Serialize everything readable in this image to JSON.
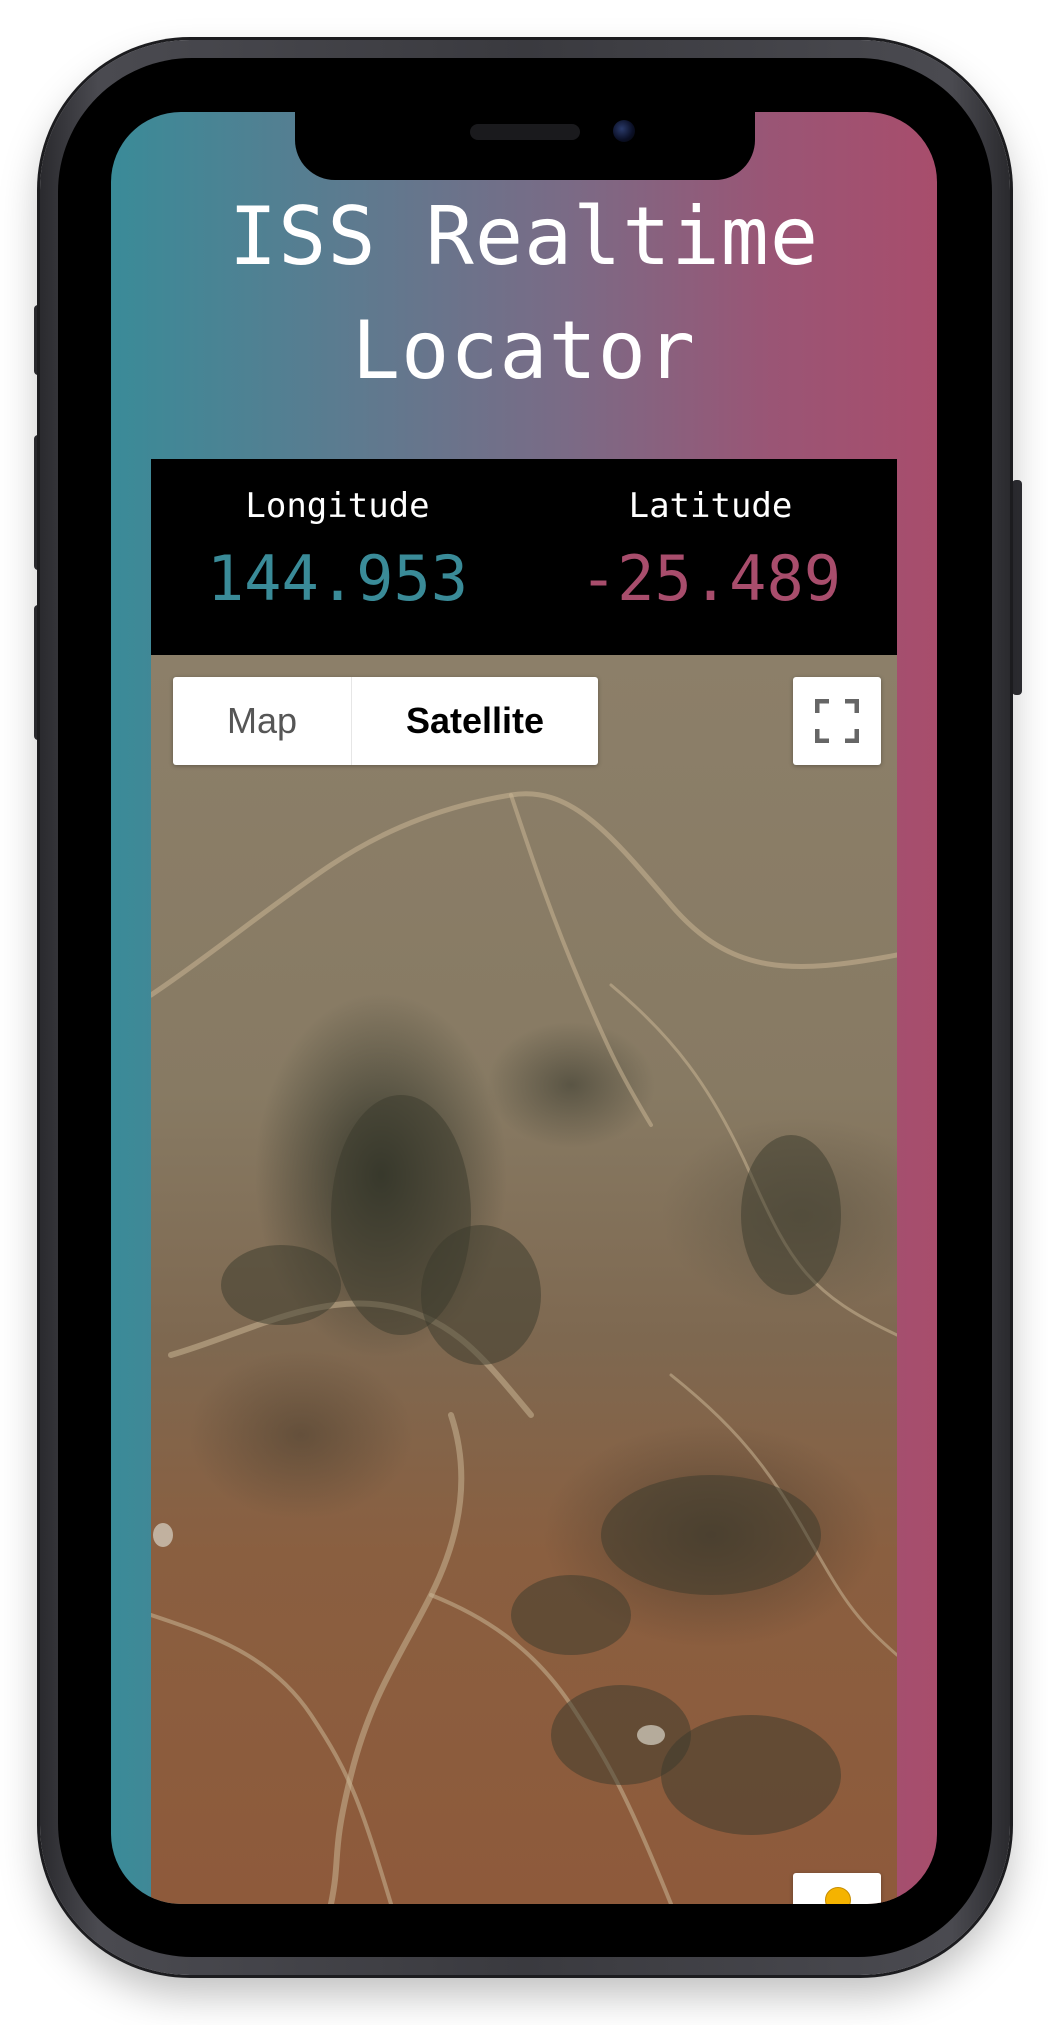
{
  "app": {
    "title": "ISS Realtime Locator"
  },
  "coordinates": {
    "longitude_label": "Longitude",
    "longitude_value": "144.953",
    "latitude_label": "Latitude",
    "latitude_value": "-25.489"
  },
  "map": {
    "type_options": [
      "Map",
      "Satellite"
    ],
    "selected_type": "Satellite",
    "controls": {
      "fullscreen_icon": "fullscreen-icon",
      "street_view_icon": "pegman-icon"
    }
  },
  "colors": {
    "gradient_left": "#3a8b98",
    "gradient_right": "#a84d6c",
    "longitude_value": "#3a8b98",
    "latitude_value": "#a84d6c",
    "panel_background": "#000000"
  }
}
